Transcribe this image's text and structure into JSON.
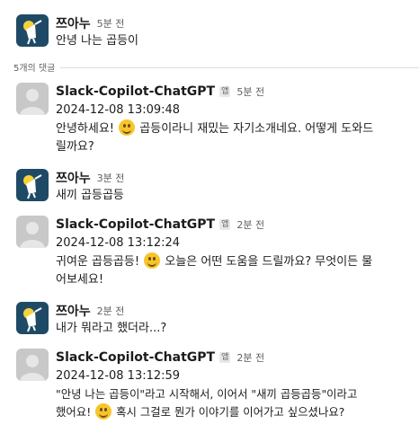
{
  "parent": {
    "author": "쯔아누",
    "time": "5분 전",
    "text": "안녕 나는 곱등이"
  },
  "replies_label": "5개의 댓글",
  "replies": [
    {
      "author": "Slack-Copilot-ChatGPT",
      "app_badge": "앱",
      "time": "5분 전",
      "timestamp": "2024-12-08 13:09:48",
      "text_before_emoji": "안녕하세요!",
      "emoji": "smiling-face",
      "text_after_emoji": "곱등이라니 재밌는 자기소개네요. 어떻게 도와드",
      "text_line2": "릴까요?"
    },
    {
      "author": "쯔아누",
      "time": "3분 전",
      "text": "새끼 곱등곱등"
    },
    {
      "author": "Slack-Copilot-ChatGPT",
      "app_badge": "앱",
      "time": "2분 전",
      "timestamp": "2024-12-08 13:12:24",
      "text_before_emoji": "귀여운 곱등곱등!",
      "emoji": "grinning-face",
      "text_after_emoji": "오늘은 어떤 도움을 드릴까요? 무엇이든 물",
      "text_line2": "어보세요!"
    },
    {
      "author": "쯔아누",
      "time": "2분 전",
      "text": "내가 뭐라고 했더라...?"
    },
    {
      "author": "Slack-Copilot-ChatGPT",
      "app_badge": "앱",
      "time": "2분 전",
      "timestamp": "2024-12-08 13:12:59",
      "text_line1": "\"안녕 나는 곱등이\"라고 시작해서, 이어서 \"새끼 곱등곱등\"이라고",
      "text_before_emoji": "했어요!",
      "emoji": "grinning-face",
      "text_after_emoji": "혹시 그걸로 뭔가 이야기를 이어가고 싶으셨나요?"
    }
  ],
  "colors": {
    "user_avatar_bg": "#1f4a66",
    "bot_avatar_bg": "#c8c8c8",
    "emoji": "#f7c52b"
  }
}
